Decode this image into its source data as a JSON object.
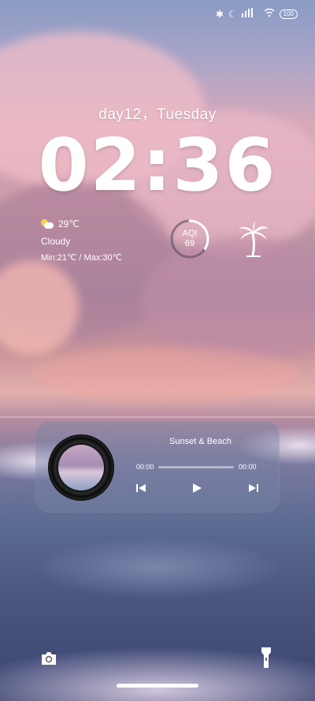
{
  "status_bar": {
    "icons": [
      "bluetooth-icon",
      "moon-icon",
      "signal-icon",
      "wifi-icon"
    ],
    "battery": "100"
  },
  "clock": {
    "date": "day12，Tuesday",
    "time": "02:36"
  },
  "weather": {
    "icon": "partly-cloudy-icon",
    "temperature": "29℃",
    "condition": "Cloudy",
    "min_max": "Min:21℃  /  Max:30℃"
  },
  "aqi": {
    "label": "AQI",
    "value": "69",
    "ring_fraction": 0.34
  },
  "decoration": {
    "icon": "palm-tree-icon"
  },
  "player": {
    "song": "Sunset & Beach",
    "elapsed": "00:00",
    "duration": "00:00",
    "progress": 0,
    "controls": [
      "previous-icon",
      "play-icon",
      "next-icon"
    ]
  },
  "bottom": {
    "left_icon": "camera-icon",
    "right_icon": "flashlight-icon"
  }
}
